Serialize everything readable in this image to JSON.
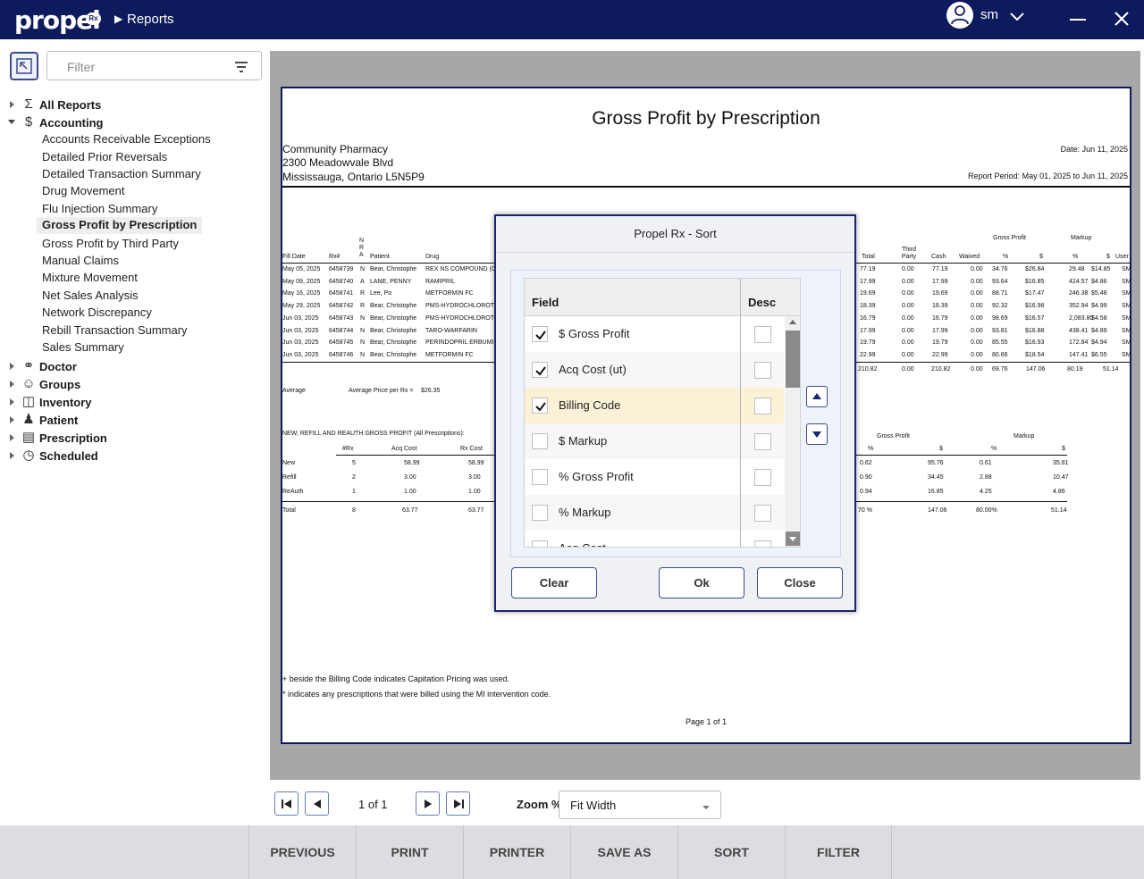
{
  "header": {
    "logo": "propel",
    "logo_badge": "Rx",
    "breadcrumb": "Reports",
    "user": "sm"
  },
  "sidebar": {
    "filter_placeholder": "Filter",
    "categories": [
      {
        "label": "All Reports",
        "icon": "sigma-icon"
      },
      {
        "label": "Accounting",
        "icon": "dollar-icon",
        "expanded": true
      },
      {
        "label": "Doctor",
        "icon": "stethoscope-icon"
      },
      {
        "label": "Groups",
        "icon": "people-icon"
      },
      {
        "label": "Inventory",
        "icon": "bottle-icon"
      },
      {
        "label": "Patient",
        "icon": "person-icon"
      },
      {
        "label": "Prescription",
        "icon": "document-icon"
      },
      {
        "label": "Scheduled",
        "icon": "clock-icon"
      }
    ],
    "accounting_reports": [
      "Accounts Receivable Exceptions",
      "Detailed Prior Reversals",
      "Detailed Transaction Summary",
      "Drug Movement",
      "Flu Injection Summary",
      "Gross Profit by Prescription",
      "Gross Profit by Third Party",
      "Manual Claims",
      "Mixture Movement",
      "Net Sales Analysis",
      "Network Discrepancy",
      "Rebill Transaction Summary",
      "Sales Summary"
    ],
    "selected_report": "Gross Profit by Prescription"
  },
  "report": {
    "title": "Gross Profit by Prescription",
    "pharmacy_name": "Community Pharmacy",
    "address1": "2300 Meadowvale Blvd",
    "address2": "Mississauga, Ontario L5N5P9",
    "date": "Date: Jun 11, 2025",
    "period": "Report Period: May 01, 2025 to Jun 11, 2025",
    "left_headers": [
      "Fill Date",
      "Rx#",
      "NRA",
      "Patient",
      "Drug"
    ],
    "right_headers": [
      "Total",
      "Third Party",
      "Cash",
      "Waived",
      "%",
      "$",
      "%",
      "$",
      "User"
    ],
    "gross_profit_group": "Gross Profit",
    "markup_group": "Markup",
    "rows": [
      {
        "date": "May 05, 2025",
        "rx": "6458739",
        "nra": "N",
        "patient": "Bear, Christophe",
        "drug": "REX NS COMPOUND (C",
        "total": "77.19",
        "tp": "0.00",
        "cash": "77.19",
        "waived": "0.00",
        "gp_pct": "34.76",
        "gp_amt": "$26.84",
        "mk_pct": "29.48",
        "mk_amt": "$14.85",
        "user": "SM"
      },
      {
        "date": "May 09, 2025",
        "rx": "6458740",
        "nra": "A",
        "patient": "LANE, PENNY",
        "drug": "RAMIPRIL",
        "total": "17.99",
        "tp": "0.00",
        "cash": "17.99",
        "waived": "0.00",
        "gp_pct": "93.64",
        "gp_amt": "$16.85",
        "mk_pct": "424.57",
        "mk_amt": "$4.86",
        "user": "SM"
      },
      {
        "date": "May 16, 2025",
        "rx": "6458741",
        "nra": "R",
        "patient": "Lee, Po",
        "drug": "METFORMIN FC",
        "total": "19.69",
        "tp": "0.00",
        "cash": "19.69",
        "waived": "0.00",
        "gp_pct": "88.71",
        "gp_amt": "$17.47",
        "mk_pct": "246.38",
        "mk_amt": "$5.48",
        "user": "SM"
      },
      {
        "date": "May 29, 2025",
        "rx": "6458742",
        "nra": "R",
        "patient": "Bear, Christophe",
        "drug": "PMS-HYDROCHLOROTH",
        "total": "18.39",
        "tp": "0.00",
        "cash": "18.39",
        "waived": "0.00",
        "gp_pct": "92.32",
        "gp_amt": "$16.98",
        "mk_pct": "352.94",
        "mk_amt": "$4.99",
        "user": "SM"
      },
      {
        "date": "Jun 03, 2025",
        "rx": "6458743",
        "nra": "N",
        "patient": "Bear, Christophe",
        "drug": "PMS-HYDROCHLOROTH",
        "total": "16.79",
        "tp": "0.00",
        "cash": "16.79",
        "waived": "0.00",
        "gp_pct": "98.69",
        "gp_amt": "$16.57",
        "mk_pct": "2,083.80",
        "mk_amt": "$4.58",
        "user": "SM"
      },
      {
        "date": "Jun 03, 2025",
        "rx": "6458744",
        "nra": "N",
        "patient": "Bear, Christophe",
        "drug": "TARO-WARFARIN",
        "total": "17.99",
        "tp": "0.00",
        "cash": "17.99",
        "waived": "0.00",
        "gp_pct": "93.81",
        "gp_amt": "$16.88",
        "mk_pct": "438.41",
        "mk_amt": "$4.89",
        "user": "SM"
      },
      {
        "date": "Jun 03, 2025",
        "rx": "6458745",
        "nra": "N",
        "patient": "Bear, Christophe",
        "drug": "PERINDOPRIL ERBUMI",
        "total": "19.79",
        "tp": "0.00",
        "cash": "19.79",
        "waived": "0.00",
        "gp_pct": "85.55",
        "gp_amt": "$16.93",
        "mk_pct": "172.84",
        "mk_amt": "$4.94",
        "user": "SM"
      },
      {
        "date": "Jun 03, 2025",
        "rx": "6458746",
        "nra": "N",
        "patient": "Bear, Christophe",
        "drug": "METFORMIN FC",
        "total": "22.99",
        "tp": "0.00",
        "cash": "22.99",
        "waived": "0.00",
        "gp_pct": "80.66",
        "gp_amt": "$18.54",
        "mk_pct": "147.41",
        "mk_amt": "$6.55",
        "user": "SM"
      }
    ],
    "totals": {
      "total": "210.82",
      "tp": "0.00",
      "cash": "210.82",
      "waived": "0.00",
      "gp_pct": "69.76",
      "gp_amt": "147.06",
      "mk_pct": "80.19",
      "mk_amt": "51.14"
    },
    "average_label": "Average",
    "average_price_label": "Average Price per Rx =",
    "average_price": "$26.35",
    "summary_title": "NEW, REFILL AND REAUTH GROSS PROFIT (All Prescriptions):",
    "summary_headers": [
      "#Rx",
      "Acq Cost",
      "Rx Cost"
    ],
    "summary_right_headers": [
      "%",
      "$",
      "%",
      "$"
    ],
    "summary_rows": [
      {
        "label": "New",
        "rx": "5",
        "acq": "58.99",
        "rxcost": "58.99",
        "gp_pct": "0.62",
        "gp_amt": "95.76",
        "mk_pct": "0.61",
        "mk_amt": "35.81"
      },
      {
        "label": "Refill",
        "rx": "2",
        "acq": "3.00",
        "rxcost": "3.00",
        "gp_pct": "0.90",
        "gp_amt": "34.45",
        "mk_pct": "2.88",
        "mk_amt": "10.47"
      },
      {
        "label": "ReAuth",
        "rx": "1",
        "acq": "1.00",
        "rxcost": "1.00",
        "gp_pct": "0.94",
        "gp_amt": "16.85",
        "mk_pct": "4.25",
        "mk_amt": "4.86"
      }
    ],
    "summary_total": {
      "label": "Total",
      "rx": "8",
      "acq": "63.77",
      "rxcost": "63.77",
      "gp_pct": "70 %",
      "gp_amt": "147.06",
      "mk_pct": "80.00%",
      "mk_amt": "51.14"
    },
    "footnote1": "+ beside the Billing Code indicates Capitation Pricing was used.",
    "footnote2": "* indicates any prescriptions that were billed using the MI intervention code.",
    "page_footer": "Page 1 of 1"
  },
  "pager": {
    "page_label": "1 of 1",
    "zoom_label": "Zoom %",
    "zoom_value": "Fit Width"
  },
  "actions": [
    "PREVIOUS",
    "PRINT",
    "PRINTER",
    "SAVE AS",
    "SORT",
    "FILTER"
  ],
  "sort_dialog": {
    "title": "Propel Rx - Sort",
    "col_field": "Field",
    "col_desc": "Desc",
    "rows": [
      {
        "label": "$ Gross Profit",
        "checked": true,
        "desc": false
      },
      {
        "label": "Acq Cost (ut)",
        "checked": true,
        "desc": false
      },
      {
        "label": "Billing Code",
        "checked": true,
        "desc": false,
        "selected": true
      },
      {
        "label": "$ Markup",
        "checked": false,
        "desc": false
      },
      {
        "label": "% Gross Profit",
        "checked": false,
        "desc": false
      },
      {
        "label": "% Markup",
        "checked": false,
        "desc": false
      },
      {
        "label": "Acq Cost",
        "checked": false,
        "desc": false
      }
    ],
    "clear": "Clear",
    "ok": "Ok",
    "close": "Close"
  }
}
